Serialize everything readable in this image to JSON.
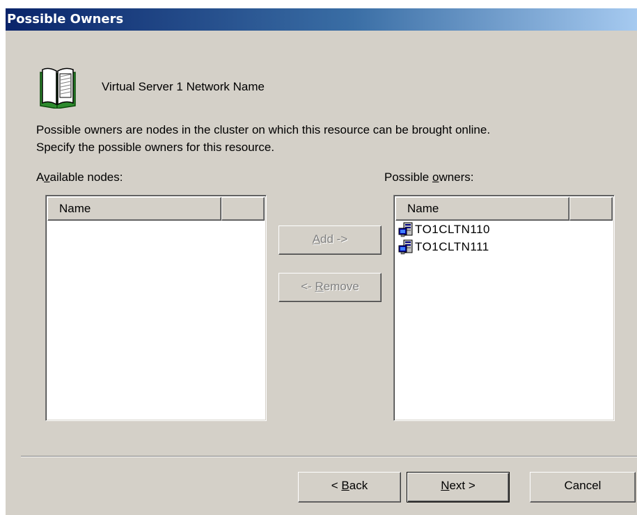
{
  "dialog": {
    "title": "Possible Owners",
    "resource_icon": "open-book-icon",
    "resource_name": "Virtual Server 1 Network Name",
    "description_line1": "Possible owners are nodes in the cluster on which this resource can be brought online.",
    "description_line2": "Specify the possible owners for this resource."
  },
  "available": {
    "label_pre": "A",
    "label_key": "v",
    "label_post": "ailable nodes:",
    "columns": [
      "Name",
      ""
    ],
    "items": []
  },
  "owners": {
    "label_pre": "Possible ",
    "label_key": "o",
    "label_post": "wners:",
    "columns": [
      "Name",
      ""
    ],
    "items": [
      {
        "name": "TO1CLTN110",
        "icon": "cluster-node-icon"
      },
      {
        "name": "TO1CLTN111",
        "icon": "cluster-node-icon"
      }
    ]
  },
  "buttons": {
    "add_key": "A",
    "add_rest": "dd ->",
    "remove_pre": "<- ",
    "remove_key": "R",
    "remove_rest": "emove",
    "back_pre": "< ",
    "back_key": "B",
    "back_rest": "ack",
    "next_key": "N",
    "next_rest": "ext >",
    "cancel": "Cancel"
  },
  "colors": {
    "title_gradient_start": "#0a246a",
    "title_gradient_end": "#a6caf0",
    "dialog_face": "#d4d0c8"
  }
}
